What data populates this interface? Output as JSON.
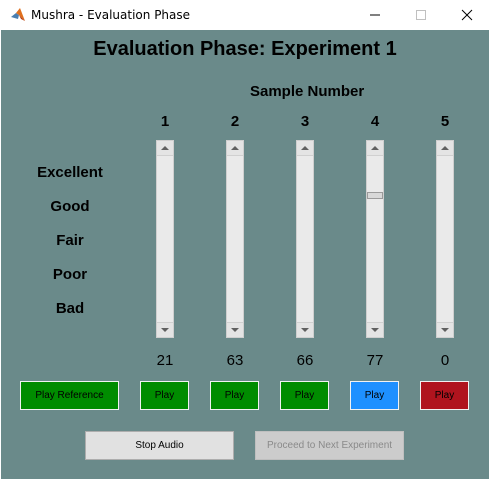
{
  "window": {
    "title": "Mushra - Evaluation Phase",
    "minimize_glyph": "—",
    "close_glyph": "✕"
  },
  "page": {
    "heading": "Evaluation Phase: Experiment 1",
    "sample_header": "Sample Number"
  },
  "scale_labels": [
    "Excellent",
    "Good",
    "Fair",
    "Poor",
    "Bad"
  ],
  "samples": [
    {
      "number": "1",
      "value": "21",
      "level": 0.0,
      "play_label": "Play",
      "button_color": "#008c00"
    },
    {
      "number": "2",
      "value": "63",
      "level": 0.0,
      "play_label": "Play",
      "button_color": "#008c00"
    },
    {
      "number": "3",
      "value": "66",
      "level": 0.0,
      "play_label": "Play",
      "button_color": "#008c00"
    },
    {
      "number": "4",
      "value": "77",
      "level": 0.77,
      "play_label": "Play",
      "button_color": "#1e90ff"
    },
    {
      "number": "5",
      "value": "0",
      "level": 0.0,
      "play_label": "Play",
      "button_color": "#b0141e"
    }
  ],
  "buttons": {
    "play_reference": "Play Reference",
    "play_reference_color": "#008c00",
    "stop_audio": "Stop Audio",
    "proceed": "Proceed to Next Experiment"
  },
  "icons": {
    "app": "matlab-icon",
    "minimize": "minimize-icon",
    "maximize": "maximize-icon",
    "close": "close-icon"
  }
}
